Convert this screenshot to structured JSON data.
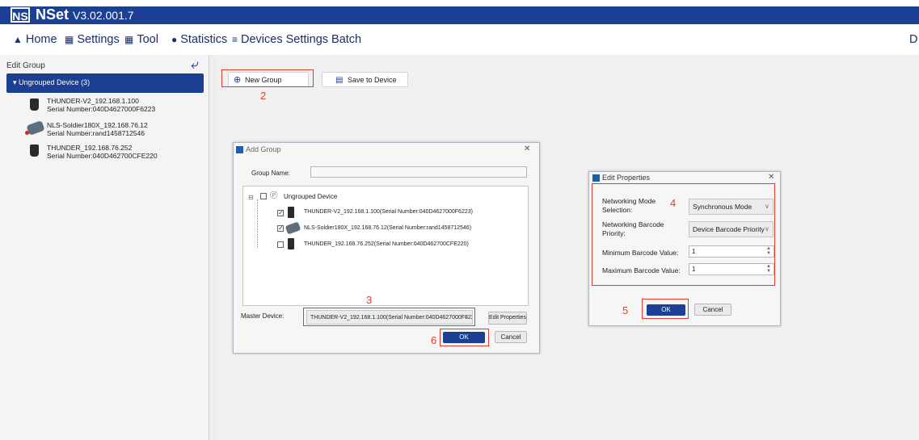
{
  "app": {
    "logo": "NS",
    "title": "NSet",
    "version": "V3.02.001.7"
  },
  "menu": {
    "items": [
      {
        "icon": "home-icon",
        "label": "Home"
      },
      {
        "icon": "settings-icon",
        "label": "Settings"
      },
      {
        "icon": "tool-icon",
        "label": "Tool"
      },
      {
        "icon": "statistics-icon",
        "label": "Statistics"
      },
      {
        "icon": "batch-icon",
        "label": "Devices Settings Batch"
      }
    ],
    "overflow_label": "D"
  },
  "left_panel": {
    "title": "Edit Group",
    "group_header": "▾ Ungrouped Device (3)",
    "devices": [
      {
        "name": "THUNDER-V2_192.168.1.100",
        "serial": "Serial Number:040D4627000F6223"
      },
      {
        "name": "NLS-Soldier180X_192.168.76.12",
        "serial": "Serial Number:rand1458712546"
      },
      {
        "name": "THUNDER_192.168.76.252",
        "serial": "Serial Number:040D462700CFE220"
      }
    ]
  },
  "toolbar": {
    "new_group_label": "New Group",
    "save_label": "Save to Device"
  },
  "annotations": {
    "n2": "2",
    "n3": "3",
    "n4": "4",
    "n5": "5",
    "n6": "6"
  },
  "add_group": {
    "title": "Add Group",
    "group_name_label": "Group Name:",
    "group_name_value": "",
    "root_label": "Ungrouped Device",
    "devices": [
      {
        "label": "THUNDER-V2_192.168.1.100(Serial Number:040D4627000F6223)",
        "checked": "✓"
      },
      {
        "label": "NLS-Soldier180X_192.168.76.12(Serial Number:rand1458712546)",
        "checked": "✓"
      },
      {
        "label": "THUNDER_192.168.76.252(Serial Number:040D462700CFE220)",
        "checked": ""
      }
    ],
    "master_label": "Master Device:",
    "master_value": "THUNDER-V2_192.168.1.100(Serial Number:040D4627000F6223)",
    "edit_properties_label": "Edit Properties",
    "ok_label": "OK",
    "cancel_label": "Cancel"
  },
  "edit_properties": {
    "title": "Edit Properties",
    "networking_mode_label": "Networking Mode Selection:",
    "networking_mode_value": "Synchronous Mode",
    "barcode_priority_label": "Networking Barcode Priority:",
    "barcode_priority_value": "Device Barcode Priority",
    "min_label": "Minimum Barcode Value:",
    "min_value": "1",
    "max_label": "Maximum Barcode Value:",
    "max_value": "1",
    "ok_label": "OK",
    "cancel_label": "Cancel"
  }
}
